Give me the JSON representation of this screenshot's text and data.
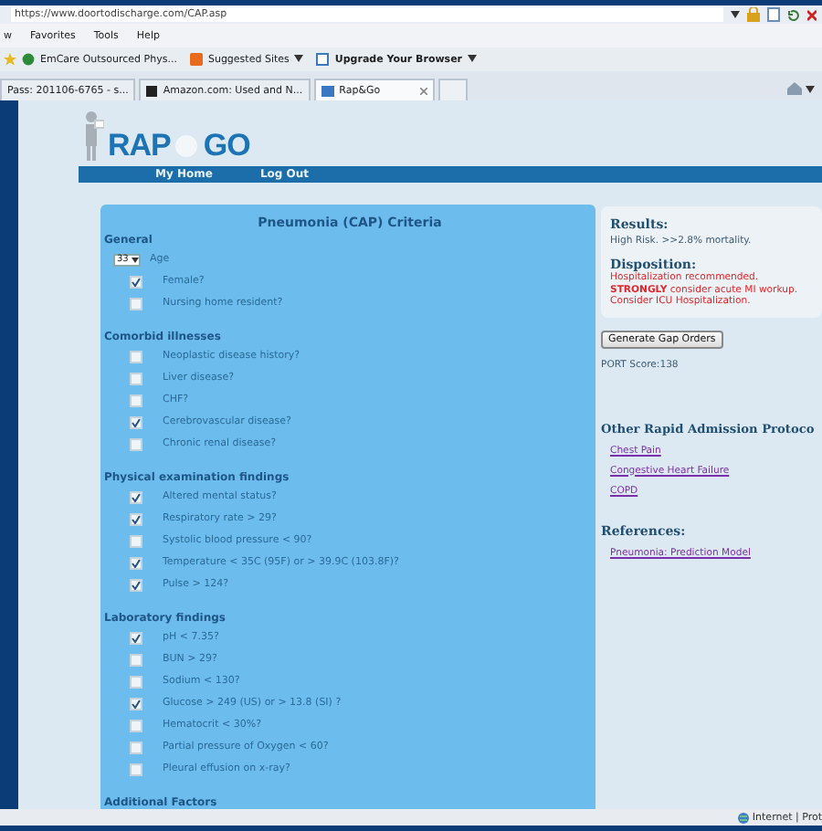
{
  "browser": {
    "address": "https://www.doortodischarge.com/CAP.asp",
    "menu": [
      "w",
      "Favorites",
      "Tools",
      "Help"
    ],
    "favorites": [
      {
        "label": "EmCare Outsourced Phys...",
        "bold": false,
        "caret": false
      },
      {
        "label": "Suggested Sites",
        "bold": false,
        "caret": true
      },
      {
        "label": "Upgrade Your Browser",
        "bold": true,
        "caret": true
      }
    ],
    "tabs": [
      {
        "label": "Pass: 201106-6765 - s...",
        "selected": false,
        "closable": false
      },
      {
        "label": "Amazon.com: Used and N...",
        "selected": false,
        "closable": false
      },
      {
        "label": "Rap&Go",
        "selected": true,
        "closable": true
      }
    ],
    "status": "Internet | Prot"
  },
  "site": {
    "logo": [
      "RAP",
      "GO"
    ],
    "nav": [
      "My Home",
      "Log Out"
    ]
  },
  "criteria": {
    "title": "Pneumonia (CAP) Criteria",
    "sections": [
      {
        "heading": "General",
        "items": [
          {
            "kind": "select",
            "value": "33",
            "label": "Age"
          },
          {
            "kind": "checkbox",
            "label": "Female?",
            "checked": true
          },
          {
            "kind": "checkbox",
            "label": "Nursing home resident?",
            "checked": false
          }
        ]
      },
      {
        "heading": "Comorbid illnesses",
        "items": [
          {
            "kind": "checkbox",
            "label": "Neoplastic disease history?",
            "checked": false
          },
          {
            "kind": "checkbox",
            "label": "Liver disease?",
            "checked": false
          },
          {
            "kind": "checkbox",
            "label": "CHF?",
            "checked": false
          },
          {
            "kind": "checkbox",
            "label": "Cerebrovascular disease?",
            "checked": true
          },
          {
            "kind": "checkbox",
            "label": "Chronic renal disease?",
            "checked": false
          }
        ]
      },
      {
        "heading": "Physical examination findings",
        "items": [
          {
            "kind": "checkbox",
            "label": "Altered mental status?",
            "checked": true
          },
          {
            "kind": "checkbox",
            "label": "Respiratory rate > 29?",
            "checked": true
          },
          {
            "kind": "checkbox",
            "label": "Systolic blood pressure < 90?",
            "checked": false
          },
          {
            "kind": "checkbox",
            "label": "Temperature < 35C (95F) or > 39.9C (103.8F)?",
            "checked": true
          },
          {
            "kind": "checkbox",
            "label": "Pulse > 124?",
            "checked": true
          }
        ]
      },
      {
        "heading": "Laboratory findings",
        "items": [
          {
            "kind": "checkbox",
            "label": "pH < 7.35?",
            "checked": true
          },
          {
            "kind": "checkbox",
            "label": "BUN > 29?",
            "checked": false
          },
          {
            "kind": "checkbox",
            "label": "Sodium < 130?",
            "checked": false
          },
          {
            "kind": "checkbox",
            "label": "Glucose > 249 (US) or > 13.8 (SI) ?",
            "checked": true
          },
          {
            "kind": "checkbox",
            "label": "Hematocrit < 30%?",
            "checked": false
          },
          {
            "kind": "checkbox",
            "label": "Partial pressure of Oxygen < 60?",
            "checked": false
          },
          {
            "kind": "checkbox",
            "label": "Pleural effusion on x-ray?",
            "checked": false
          }
        ]
      },
      {
        "heading": "Additional Factors"
      }
    ]
  },
  "results": {
    "results_heading": "Results:",
    "risk": "High Risk. >>2.8% mortality.",
    "disposition_heading": "Disposition:",
    "disposition": [
      "Hospitalization recommended.",
      "**STRONGLY** consider acute MI workup.",
      "Consider ICU Hospitalization."
    ],
    "button": "Generate Gap Orders",
    "score": "PORT Score:138",
    "protocols_heading": "Other Rapid Admission Protoco",
    "protocols": [
      "Chest Pain",
      "Congestive Heart Failure",
      "COPD"
    ],
    "references_heading": "References:",
    "references": [
      "Pneumonia: Prediction Model"
    ]
  }
}
